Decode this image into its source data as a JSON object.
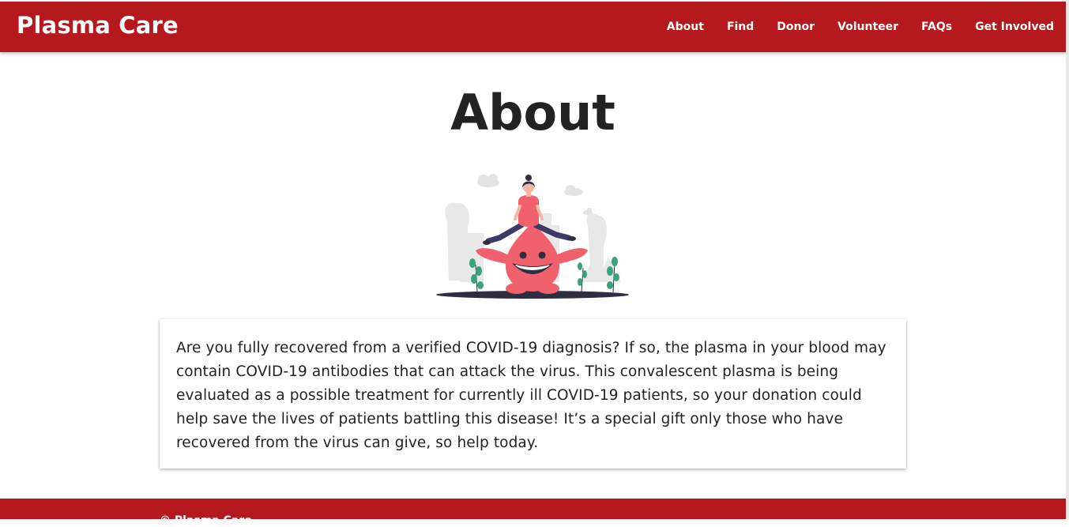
{
  "navbar": {
    "brand": "Plasma Care",
    "links": [
      "About",
      "Find",
      "Donor",
      "Volunteer",
      "FAQs",
      "Get Involved"
    ]
  },
  "main": {
    "title": "About",
    "illustration_icon": "blood-drop-character-illustration",
    "description": "Are you fully recovered from a verified COVID-19 diagnosis? If so, the plasma in your blood may contain COVID-19 antibodies that can attack the virus. This convalescent plasma is being evaluated as a possible treatment for currently ill COVID-19 patients, so your donation could help save the lives of patients battling this disease! It’s a special gift only those who have recovered from the virus can give, so help today."
  },
  "footer": {
    "text": "© Plasma Care"
  },
  "colors": {
    "brand_red": "#b5191d",
    "text_dark": "#222222",
    "drop_pink": "#f0606d",
    "plant_green": "#3aa37a",
    "shadow_navy": "#2f2e41"
  }
}
